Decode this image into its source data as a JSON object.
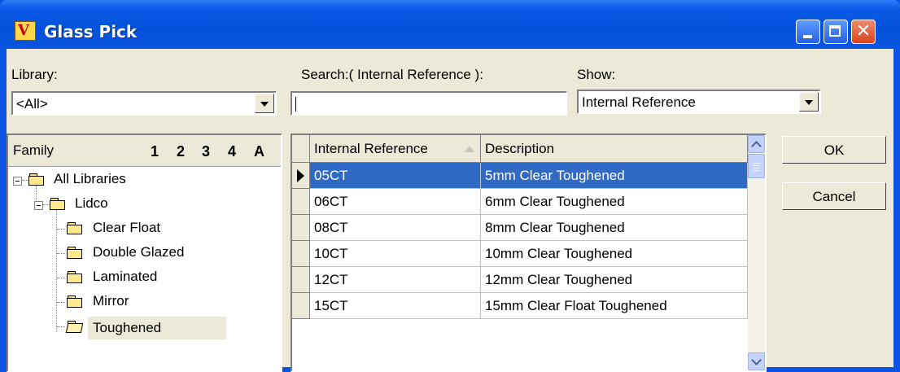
{
  "window": {
    "title": "Glass Pick",
    "app_icon_letter": "V",
    "close_glyph": "✕"
  },
  "library": {
    "label": "Library:",
    "value": "<All>"
  },
  "search": {
    "label": "Search:( Internal Reference ):",
    "value": ""
  },
  "show": {
    "label": "Show:",
    "value": "Internal Reference"
  },
  "family": {
    "header": "Family",
    "levels": [
      "1",
      "2",
      "3",
      "4",
      "A"
    ],
    "tree": [
      {
        "label": "All Libraries",
        "depth": 0,
        "expanded": true
      },
      {
        "label": "Lidco",
        "depth": 1,
        "expanded": true
      },
      {
        "label": "Clear Float",
        "depth": 2
      },
      {
        "label": "Double Glazed",
        "depth": 2
      },
      {
        "label": "Laminated",
        "depth": 2
      },
      {
        "label": "Mirror",
        "depth": 2
      },
      {
        "label": "Toughened",
        "depth": 2,
        "selected": true,
        "open": true
      }
    ]
  },
  "grid": {
    "columns": [
      "Internal Reference",
      "Description"
    ],
    "sort_column": "Internal Reference",
    "selected_row": 0,
    "rows": [
      {
        "ref": "05CT",
        "desc": "5mm Clear Toughened"
      },
      {
        "ref": "06CT",
        "desc": "6mm Clear Toughened"
      },
      {
        "ref": "08CT",
        "desc": "8mm Clear Toughened"
      },
      {
        "ref": "10CT",
        "desc": "10mm Clear Toughened"
      },
      {
        "ref": "12CT",
        "desc": "12mm Clear Toughened"
      },
      {
        "ref": "15CT",
        "desc": "15mm Clear Float Toughened"
      }
    ]
  },
  "buttons": {
    "ok": "OK",
    "cancel": "Cancel"
  },
  "colors": {
    "titlebar": "#0a54e0",
    "selection": "#316ac5",
    "face": "#ece9d8"
  }
}
